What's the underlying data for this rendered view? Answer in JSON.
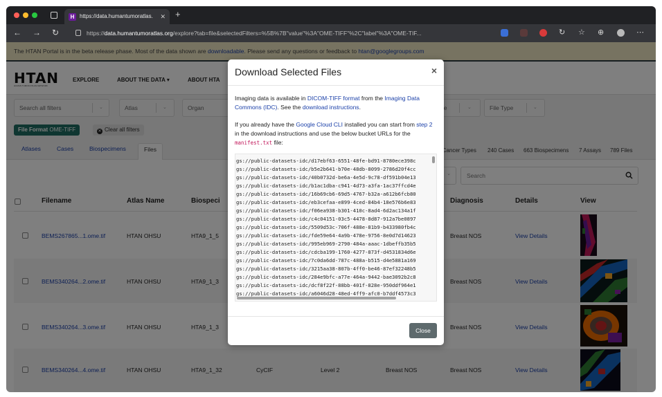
{
  "browser": {
    "tab_title": "https://data.humantumoratlas.",
    "url_host": "data.humantumoratlas.org",
    "url_prefix": "https://",
    "url_path": "/explore?tab=file&selectedFilters=%5B%7B\"value\"%3A\"OME-TIFF\"%2C\"label\"%3A\"OME-TIF..."
  },
  "banner": {
    "text_before": "The HTAN Portal is in the beta release phase. Most of the data shown are",
    "link_downloadable": "downloadable",
    "text_middle": ". Please send any questions or feedback to",
    "link_email": "htan@googlegroups.com"
  },
  "header": {
    "logo": "HTAN",
    "logo_sub": "HUMAN TUMOR ATLAS NETWORK",
    "nav": [
      "EXPLORE",
      "ABOUT THE DATA ▾",
      "ABOUT HTA"
    ]
  },
  "filters": {
    "search_placeholder": "Search all filters",
    "atlas": "Atlas",
    "organ": "Organ",
    "type": "pe",
    "file_type": "File Type"
  },
  "chips": {
    "format_label": "File Format",
    "format_value": "OME-TIFF",
    "clear_all": "Clear all filters"
  },
  "entity_tabs": [
    "Atlases",
    "Cases",
    "Biospecimens",
    "Files"
  ],
  "counts": [
    "2 Cancer Types",
    "240 Cases",
    "663 Biospecimens",
    "7 Assays",
    "789 Files"
  ],
  "table": {
    "search_placeholder": "Search",
    "headers": [
      "Filename",
      "Atlas Name",
      "Biospeci",
      "Diagnosis",
      "Details",
      "View"
    ],
    "rows": [
      {
        "filename": "BEMS267865...1.ome.tif",
        "atlas": "HTAN OHSU",
        "biospecimen": "HTA9_1_5",
        "assay": "",
        "level": "",
        "organ": "",
        "diagnosis": "Breast NOS",
        "details": "View Details"
      },
      {
        "filename": "BEMS340264...2.ome.tif",
        "atlas": "HTAN OHSU",
        "biospecimen": "HTA9_1_3",
        "assay": "",
        "level": "",
        "organ": "",
        "diagnosis": "Breast NOS",
        "details": "View Details"
      },
      {
        "filename": "BEMS340264...3.ome.tif",
        "atlas": "HTAN OHSU",
        "biospecimen": "HTA9_1_3",
        "assay": "",
        "level": "",
        "organ": "",
        "diagnosis": "Breast NOS",
        "details": "View Details"
      },
      {
        "filename": "BEMS340264...4.ome.tif",
        "atlas": "HTAN OHSU",
        "biospecimen": "HTA9_1_32",
        "assay": "CyCIF",
        "level": "Level 2",
        "organ": "Breast NOS",
        "diagnosis": "Breast NOS",
        "details": "View Details"
      }
    ]
  },
  "modal": {
    "title": "Download Selected Files",
    "close_symbol": "×",
    "p1_a": "Imaging data is available in",
    "p1_link1": "DICOM-TIFF format",
    "p1_b": "from the",
    "p1_link2": "Imaging Data Commons (IDC)",
    "p1_c": ". See the",
    "p1_link3": "download instructions",
    "p1_d": ".",
    "p2_a": "If you already have the",
    "p2_link1": "Google Cloud CLI",
    "p2_b": "installed you can start from",
    "p2_link2": "step 2",
    "p2_c": "in the download instructions and use the below bucket URLs for the",
    "p2_code": "manifest.txt",
    "p2_d": "file:",
    "bucket_urls": [
      "gs://public-datasets-idc/d17ebf63-6551-48fe-bd91-8780ece398c",
      "gs://public-datasets-idc/b5e2b641-b70e-48db-8099-2786d20f4cc",
      "gs://public-datasets-idc/40b0732d-be6a-4e5d-9c78-df591b04e13",
      "gs://public-datasets-idc/b1ac1dba-c941-4d73-a3fa-1ac37ffcd4e",
      "gs://public-datasets-idc/16b69cb6-69d5-4767-b32a-a612b6fcb80",
      "gs://public-datasets-idc/eb3cefaa-e899-4ced-84b4-18e576b6e83",
      "gs://public-datasets-idc/f06ea938-b301-410c-8ad4-6d2ac134a1f",
      "gs://public-datasets-idc/c4c04151-03c5-4478-8d87-912a7be0897",
      "gs://public-datasets-idc/5509d53c-706f-488e-81b9-b433980fb4c",
      "gs://public-datasets-idc/fde59e64-4a9b-478e-9756-8e0d7d14623",
      "gs://public-datasets-idc/995eb969-2790-484a-aaac-1dbeffb35b5",
      "gs://public-datasets-idc/cdcba199-1760-4277-873f-d4531834d6e",
      "gs://public-datasets-idc/7c0da6dd-787c-488a-b515-d4e5881a169",
      "gs://public-datasets-idc/3215aa38-807b-4ff0-be46-87ef32248b5",
      "gs://public-datasets-idc/284e9bfc-a77e-464a-9442-bae3092b2c8",
      "gs://public-datasets-idc/dcf8f22f-88bb-401f-828e-950ddf964e1",
      "gs://public-datasets-idc/a6046d28-48ed-4ff9-afc0-b7ddf4573c3"
    ],
    "close_button": "Close"
  }
}
